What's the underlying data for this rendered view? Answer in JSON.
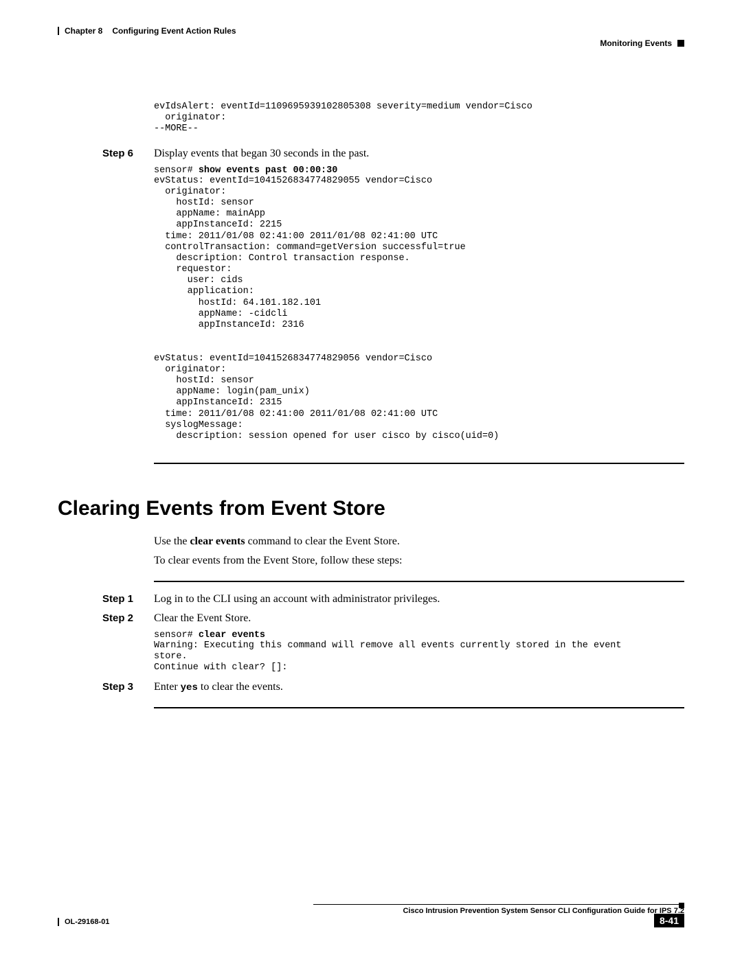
{
  "header": {
    "chapter_num": "Chapter 8",
    "chapter_title": "Configuring Event Action Rules",
    "section_name": "Monitoring Events"
  },
  "intro_code": "evIdsAlert: eventId=1109695939102805308 severity=medium vendor=Cisco\n  originator:\n--MORE--",
  "step6": {
    "label": "Step 6",
    "text": "Display events that began 30 seconds in the past.",
    "prompt": "sensor# ",
    "cmd": "show events past 00:00:30",
    "output": "evStatus: eventId=1041526834774829055 vendor=Cisco\n  originator:\n    hostId: sensor\n    appName: mainApp\n    appInstanceId: 2215\n  time: 2011/01/08 02:41:00 2011/01/08 02:41:00 UTC\n  controlTransaction: command=getVersion successful=true\n    description: Control transaction response.\n    requestor:\n      user: cids\n      application:\n        hostId: 64.101.182.101\n        appName: -cidcli\n        appInstanceId: 2316\n\n\nevStatus: eventId=1041526834774829056 vendor=Cisco\n  originator:\n    hostId: sensor\n    appName: login(pam_unix)\n    appInstanceId: 2315\n  time: 2011/01/08 02:41:00 2011/01/08 02:41:00 UTC\n  syslogMessage:\n    description: session opened for user cisco by cisco(uid=0)"
  },
  "section2": {
    "heading": "Clearing Events from Event Store",
    "intro1_pre": "Use the ",
    "intro1_bold": "clear events",
    "intro1_post": " command to clear the Event Store.",
    "intro2": "To clear events from the Event Store, follow these steps:",
    "step1": {
      "label": "Step 1",
      "text": "Log in to the CLI using an account with administrator privileges."
    },
    "step2": {
      "label": "Step 2",
      "text": "Clear the Event Store.",
      "prompt": "sensor# ",
      "cmd": "clear events",
      "output": "Warning: Executing this command will remove all events currently stored in the event \nstore.\nContinue with clear? []:"
    },
    "step3": {
      "label": "Step 3",
      "text_pre": "Enter ",
      "text_cmd": "yes",
      "text_post": " to clear the events."
    }
  },
  "footer": {
    "guide_title": "Cisco Intrusion Prevention System Sensor CLI Configuration Guide for IPS 7.2",
    "doc_num": "OL-29168-01",
    "page_num": "8-41"
  }
}
